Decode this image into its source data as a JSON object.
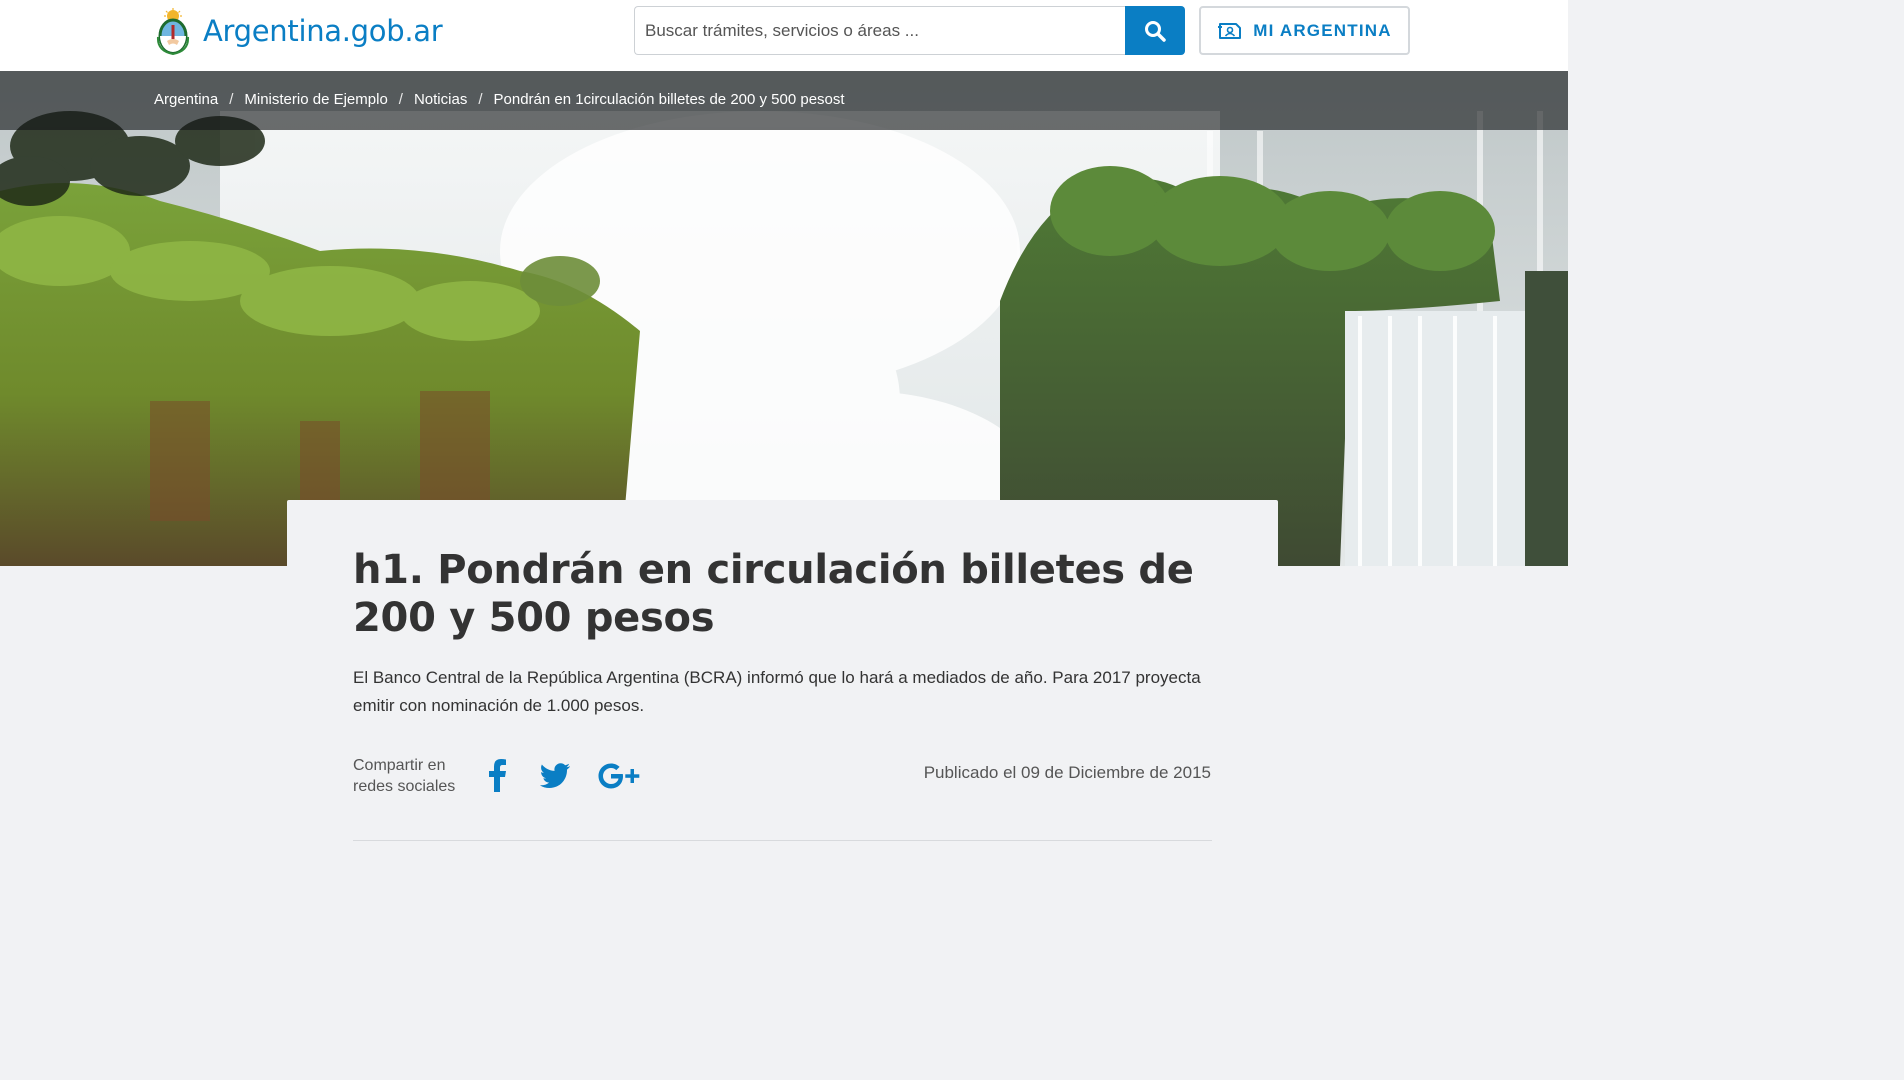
{
  "header": {
    "logo_text": "Argentina.gob.ar",
    "search_placeholder": "Buscar trámites, servicios o áreas ...",
    "mi_argentina_label": "MI ARGENTINA"
  },
  "breadcrumb": {
    "items": [
      "Argentina",
      "Ministerio de Ejemplo",
      "Noticias",
      "Pondrán en 1circulación billetes de 200 y 500 pesost"
    ],
    "separator": "/"
  },
  "article": {
    "title": "h1. Pondrán en circulación billetes de 200 y 500 pesos",
    "lead": "El Banco Central de la República Argentina (BCRA) informó que lo hará a mediados de año. Para 2017 proyecta emitir con nominación de 1.000 pesos.",
    "share_label": "Compartir en redes sociales",
    "published": "Publicado el 09 de Diciembre de 2015"
  },
  "icons": {
    "search": "search-icon",
    "mi_argentina": "id-card-icon",
    "facebook": "facebook-icon",
    "twitter": "twitter-icon",
    "google_plus": "google-plus-icon"
  },
  "colors": {
    "brand_blue": "#0a7ec4",
    "page_background": "#f1f2f4",
    "text_dark": "#333333"
  }
}
